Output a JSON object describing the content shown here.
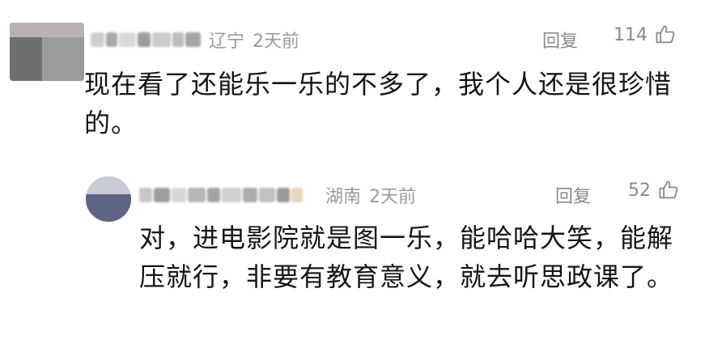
{
  "comments": [
    {
      "location": "辽宁",
      "time": "2天前",
      "reply_label": "回复",
      "like_count": "114",
      "text": "现在看了还能乐一乐的不多了，我个人还是很珍惜的。"
    },
    {
      "location": "湖南",
      "time": "2天前",
      "reply_label": "回复",
      "like_count": "52",
      "text": "对，进电影院就是图一乐，能哈哈大笑，能解压就行，非要有教育意义，就去听思政课了。"
    }
  ]
}
